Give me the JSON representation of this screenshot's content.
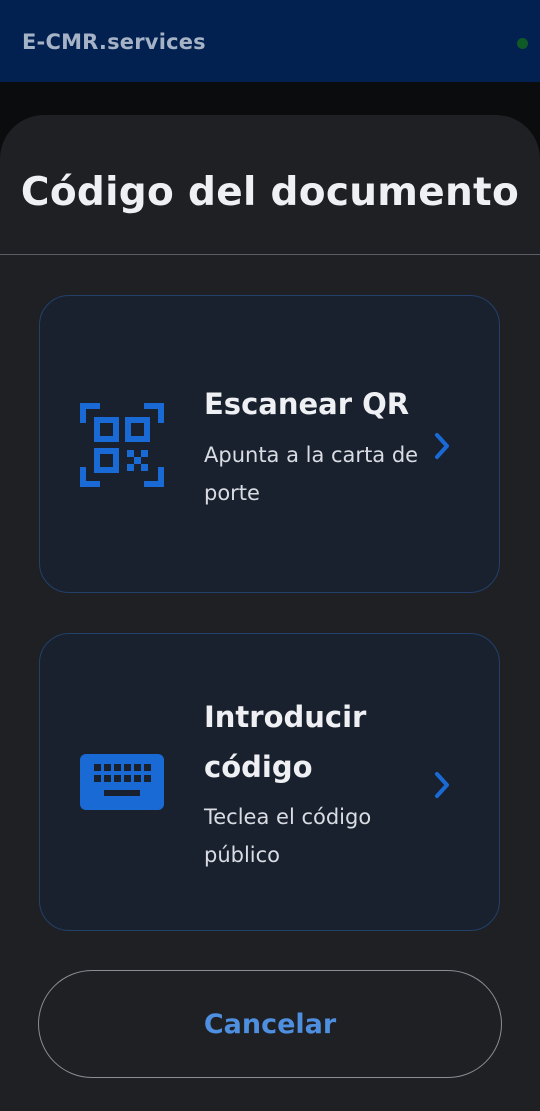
{
  "app": {
    "title": "E-CMR.services"
  },
  "sheet": {
    "title": "Código del documento"
  },
  "options": {
    "scan_qr": {
      "title": "Escanear QR",
      "description": "Apunta a la carta de porte",
      "icon": "qr-code-icon"
    },
    "enter_code": {
      "title": "Introducir código",
      "description": "Teclea el código público",
      "icon": "keyboard-icon"
    }
  },
  "cancel_label": "Cancelar",
  "colors": {
    "topbar": "#022150",
    "sheet": "#1e2024",
    "card": "#1a212e",
    "accent": "#1a6ad6",
    "cancel_text": "#4f8fe0",
    "status_dot": "#0f5a26"
  }
}
